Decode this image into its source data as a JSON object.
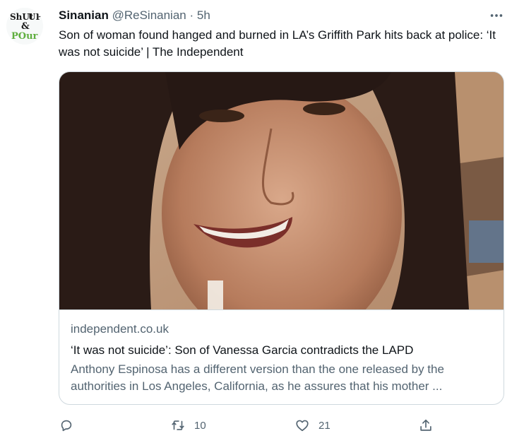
{
  "tweet": {
    "author_name": "Sinanian",
    "handle": "@ReSinanian",
    "separator": "·",
    "time": "5h",
    "text": "Son of woman found hanged and burned in LA’s Griffith Park hits back at police: ‘It was not suicide’ | The Independent",
    "avatar_text": [
      "ShUt",
      "UP",
      "&",
      "POur"
    ]
  },
  "card": {
    "domain": "independent.co.uk",
    "title": "‘It was not suicide’: Son of Vanessa Garcia contradicts the LAPD",
    "description": "Anthony Espinosa has a different version than the one released by the authorities in Los Angeles, California, as he assures that his mother ..."
  },
  "actions": {
    "reply_count": "",
    "retweet_count": "10",
    "like_count": "21"
  },
  "colors": {
    "text_primary": "#0f1419",
    "text_secondary": "#536471",
    "border": "#cfd9de",
    "avatar_green": "#5fae3e"
  },
  "icons": [
    "more-icon",
    "reply-icon",
    "retweet-icon",
    "like-icon",
    "share-icon"
  ]
}
